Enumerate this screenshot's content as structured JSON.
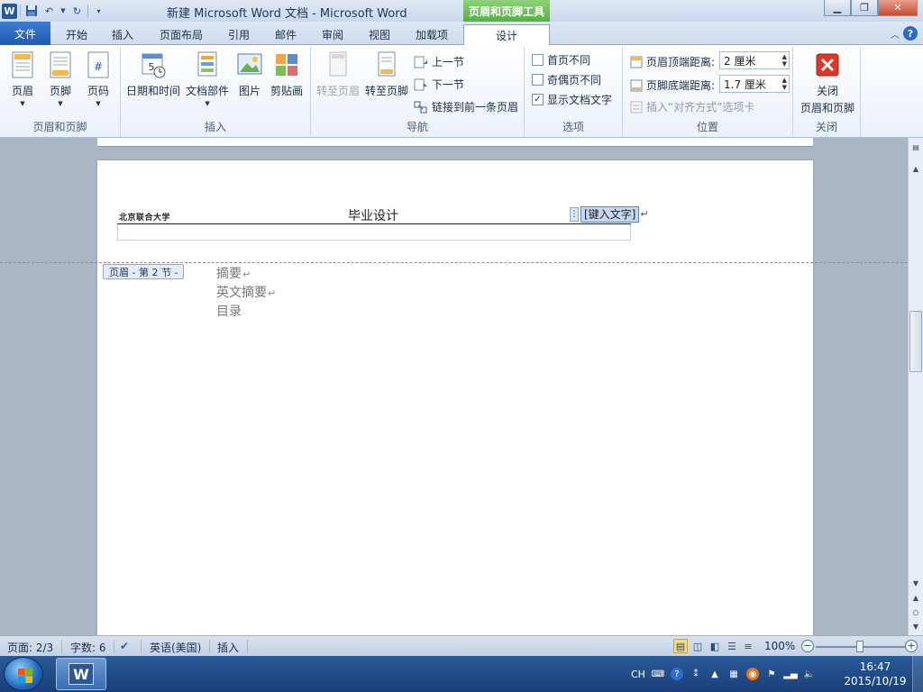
{
  "window": {
    "title": "新建 Microsoft Word 文档 - Microsoft Word",
    "context_tools": "页眉和页脚工具"
  },
  "tabs": [
    {
      "label": "文件"
    },
    {
      "label": "开始"
    },
    {
      "label": "插入"
    },
    {
      "label": "页面布局"
    },
    {
      "label": "引用"
    },
    {
      "label": "邮件"
    },
    {
      "label": "审阅"
    },
    {
      "label": "视图"
    },
    {
      "label": "加载项"
    },
    {
      "label": "设计"
    }
  ],
  "ribbon": {
    "hf": {
      "label": "页眉和页脚",
      "header": "页眉",
      "footer": "页脚",
      "page_number": "页码"
    },
    "insert": {
      "label": "插入",
      "datetime": "日期和时间",
      "quickparts": "文档部件",
      "picture": "图片",
      "clipart": "剪贴画"
    },
    "nav": {
      "label": "导航",
      "goto_header": "转至页眉",
      "goto_footer": "转至页脚",
      "prev": "上一节",
      "next": "下一节",
      "link_prev": "链接到前一条页眉"
    },
    "options": {
      "label": "选项",
      "diff_first": "首页不同",
      "diff_odd_even": "奇偶页不同",
      "show_doc_text": "显示文档文字"
    },
    "position": {
      "label": "位置",
      "header_top": "页眉顶端距离:",
      "header_top_val": "2 厘米",
      "footer_bottom": "页脚底端距离:",
      "footer_bottom_val": "1.7 厘米",
      "insert_align": "插入“对齐方式”选项卡"
    },
    "close": {
      "label": "关闭",
      "btn_line1": "关闭",
      "btn_line2": "页眉和页脚"
    }
  },
  "document": {
    "header_school": "北京联合大学",
    "header_title": "毕业设计",
    "header_placeholder": "[键入文字]",
    "section_tag": "页眉 - 第 2 节 -",
    "lines": [
      "摘要",
      "英文摘要",
      "目录"
    ]
  },
  "status": {
    "page": "页面: 2/3",
    "words": "字数: 6",
    "language": "英语(美国)",
    "mode": "插入",
    "zoom": "100%"
  },
  "taskbar": {
    "lang": "CH",
    "time": "16:47",
    "date": "2015/10/19"
  }
}
